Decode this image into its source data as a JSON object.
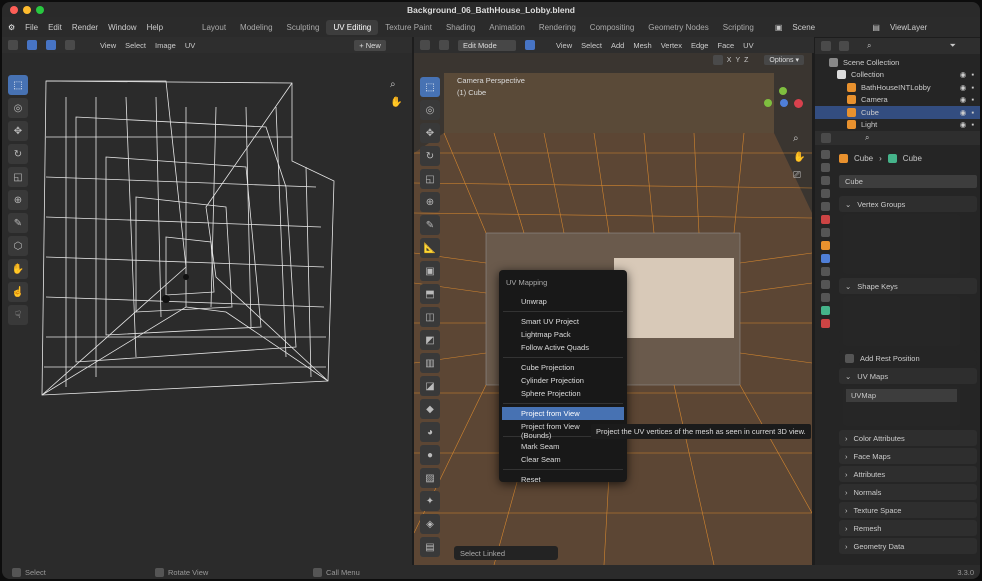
{
  "window": {
    "title": "Background_06_BathHouse_Lobby.blend"
  },
  "menubar": {
    "items": [
      "File",
      "Edit",
      "Render",
      "Window",
      "Help"
    ],
    "workspaces": [
      "Layout",
      "Modeling",
      "Sculpting",
      "UV Editing",
      "Texture Paint",
      "Shading",
      "Animation",
      "Rendering",
      "Compositing",
      "Geometry Nodes",
      "Scripting"
    ],
    "scene": "Scene",
    "viewlayer": "ViewLayer"
  },
  "uv_header": {
    "items": [
      "View",
      "Select",
      "Image",
      "UV"
    ],
    "new_label": "+ New"
  },
  "vp_header": {
    "mode": "Edit Mode",
    "items": [
      "View",
      "Select",
      "Add",
      "Mesh",
      "Vertex",
      "Edge",
      "Face",
      "UV"
    ],
    "options": "Options ▾",
    "axes": [
      "X",
      "Y",
      "Z"
    ]
  },
  "viewport": {
    "camera_label": "Camera Perspective",
    "object_label": "(1) Cube",
    "select_linked": "Select Linked"
  },
  "uv_menu": {
    "title": "UV Mapping",
    "items": [
      {
        "label": "Unwrap",
        "hl": false
      },
      {
        "sep": true
      },
      {
        "label": "Smart UV Project",
        "hl": false
      },
      {
        "label": "Lightmap Pack",
        "hl": false
      },
      {
        "label": "Follow Active Quads",
        "hl": false
      },
      {
        "sep": true
      },
      {
        "label": "Cube Projection",
        "hl": false
      },
      {
        "label": "Cylinder Projection",
        "hl": false
      },
      {
        "label": "Sphere Projection",
        "hl": false
      },
      {
        "sep": true
      },
      {
        "label": "Project from View",
        "hl": true
      },
      {
        "label": "Project from View (Bounds)",
        "hl": false
      },
      {
        "sep": true
      },
      {
        "label": "Mark Seam",
        "hl": false
      },
      {
        "label": "Clear Seam",
        "hl": false
      },
      {
        "sep": true
      },
      {
        "label": "Reset",
        "hl": false
      }
    ]
  },
  "tooltip": "Project the UV vertices of the mesh as seen in current 3D view.",
  "outliner": {
    "title": "Scene Collection",
    "rows": [
      {
        "label": "Collection",
        "indent": 0,
        "sel": false
      },
      {
        "label": "BathHouseINTLobby",
        "indent": 1,
        "sel": false
      },
      {
        "label": "Camera",
        "indent": 1,
        "sel": false
      },
      {
        "label": "Cube",
        "indent": 1,
        "sel": true
      },
      {
        "label": "Light",
        "indent": 1,
        "sel": false
      }
    ]
  },
  "properties": {
    "breadcrumb_obj": "Cube",
    "breadcrumb_data": "Cube",
    "data_name": "Cube",
    "panels": {
      "vertex_groups": "Vertex Groups",
      "shape_keys": "Shape Keys",
      "add_rest": "Add Rest Position",
      "uv_maps": "UV Maps",
      "uvmap": "UVMap"
    },
    "closed": [
      "Color Attributes",
      "Face Maps",
      "Attributes",
      "Normals",
      "Texture Space",
      "Remesh",
      "Geometry Data"
    ]
  },
  "status": {
    "select": "Select",
    "rotate": "Rotate View",
    "menu": "Call Menu",
    "version": "3.3.0"
  },
  "colors": {
    "accent": "#4772b3",
    "orange": "#e8912e"
  }
}
